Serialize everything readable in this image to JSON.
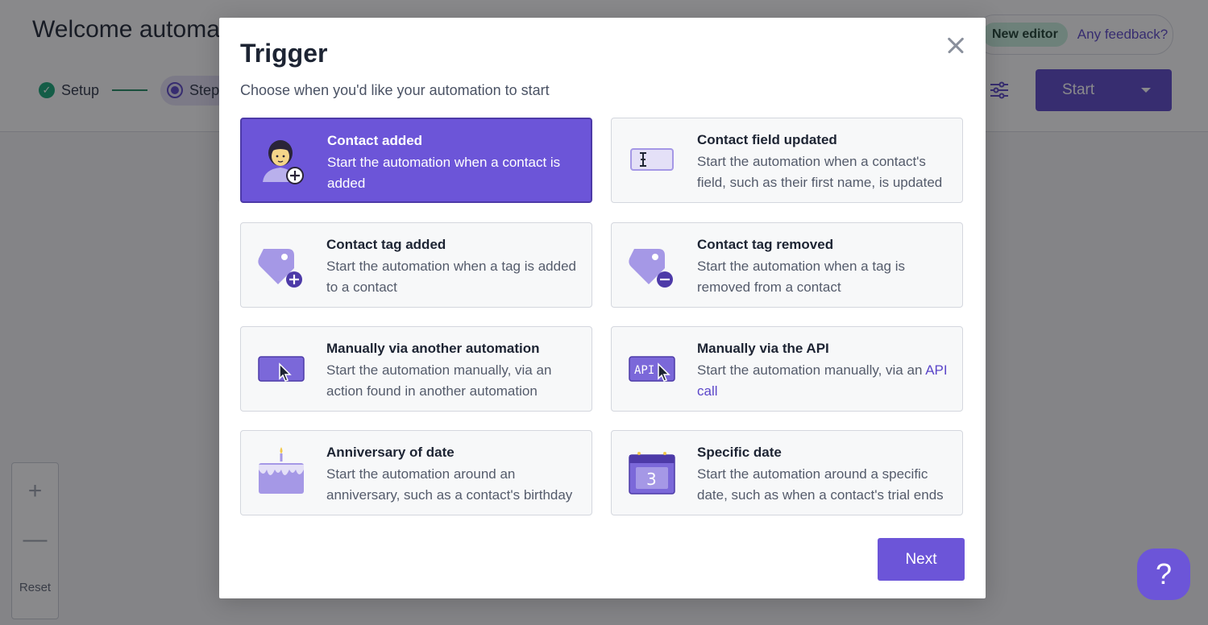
{
  "header": {
    "title": "Welcome automation",
    "steps": [
      {
        "label": "Setup",
        "state": "done"
      },
      {
        "label": "Steps",
        "state": "active"
      }
    ],
    "new_editor_badge": "New editor",
    "feedback_link": "Any feedback?",
    "start_button": "Start"
  },
  "zoom_controls": {
    "plus": "+",
    "minus": "—",
    "reset": "Reset"
  },
  "help_button": {
    "glyph": "?"
  },
  "modal": {
    "title": "Trigger",
    "subtitle": "Choose when you'd like your automation to start",
    "next_button": "Next",
    "options": [
      {
        "title": "Contact added",
        "description": "Start the automation when a contact is added",
        "icon": "contact-added-icon",
        "selected": true
      },
      {
        "title": "Contact field updated",
        "description": "Start the automation when a contact's field, such as their first name, is updated",
        "icon": "text-field-icon",
        "selected": false
      },
      {
        "title": "Contact tag added",
        "description": "Start the automation when a tag is added to a contact",
        "icon": "tag-add-icon",
        "selected": false
      },
      {
        "title": "Contact tag removed",
        "description": "Start the automation when a tag is removed from a contact",
        "icon": "tag-remove-icon",
        "selected": false
      },
      {
        "title": "Manually via another automation",
        "description": "Start the automation manually, via an action found in another automation",
        "icon": "cursor-click-icon",
        "selected": false
      },
      {
        "title": "Manually via the API",
        "description_prefix": "Start the automation manually, via an ",
        "description_link": "API call",
        "icon": "api-cursor-icon",
        "selected": false
      },
      {
        "title": "Anniversary of date",
        "description": "Start the automation around an anniversary, such as a contact's birthday",
        "icon": "cake-icon",
        "selected": false
      },
      {
        "title": "Specific date",
        "description": "Start the automation around a specific date, such as when a contact's trial ends",
        "icon": "calendar-icon",
        "selected": false
      }
    ],
    "api_icon_text": "API",
    "calendar_icon_text": "3"
  },
  "colors": {
    "accent": "#6c55d8",
    "accent_dark": "#5b46c9",
    "success": "#14a776",
    "icon_fill": "#a598e6"
  }
}
